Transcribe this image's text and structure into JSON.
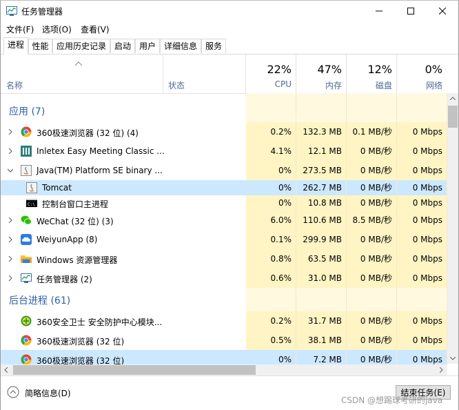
{
  "window": {
    "title": "任务管理器"
  },
  "menu": {
    "file": "文件(F)",
    "options": "选项(O)",
    "view": "查看(V)"
  },
  "tabs": [
    "进程",
    "性能",
    "应用历史记录",
    "启动",
    "用户",
    "详细信息",
    "服务"
  ],
  "header": {
    "name": "名称",
    "status": "状态",
    "cpu_pct": "22%",
    "cpu_label": "CPU",
    "mem_pct": "47%",
    "mem_label": "内存",
    "disk_pct": "12%",
    "disk_label": "磁盘",
    "net_pct": "0%",
    "net_label": "网络"
  },
  "groups": {
    "apps": "应用 (7)",
    "background": "后台进程 (61)"
  },
  "apps": [
    {
      "name": "360极速浏览器 (32 位) (4)",
      "cpu": "0.2%",
      "mem": "132.3 MB",
      "disk": "0.1 MB/秒",
      "net": "0 Mbps",
      "icon": "chrome-icon"
    },
    {
      "name": "Inletex Easy Meeting Classic ...",
      "cpu": "4.1%",
      "mem": "12.1 MB",
      "disk": "0 MB/秒",
      "net": "0 Mbps",
      "icon": "meeting-icon"
    },
    {
      "name": "Java(TM) Platform SE binary ...",
      "cpu": "0%",
      "mem": "273.5 MB",
      "disk": "0 MB/秒",
      "net": "0 Mbps",
      "icon": "java-icon"
    },
    {
      "name": "Tomcat",
      "cpu": "0%",
      "mem": "262.7 MB",
      "disk": "0 MB/秒",
      "net": "0 Mbps",
      "icon": "java-icon"
    },
    {
      "name": "控制台窗口主进程",
      "cpu": "0%",
      "mem": "10.8 MB",
      "disk": "0 MB/秒",
      "net": "0 Mbps",
      "icon": "console-icon"
    },
    {
      "name": "WeChat (32 位) (3)",
      "cpu": "6.0%",
      "mem": "110.6 MB",
      "disk": "8.5 MB/秒",
      "net": "0 Mbps",
      "icon": "wechat-icon"
    },
    {
      "name": "WeiyunApp (8)",
      "cpu": "0.1%",
      "mem": "299.9 MB",
      "disk": "0 MB/秒",
      "net": "0 Mbps",
      "icon": "weiyun-icon"
    },
    {
      "name": "Windows 资源管理器",
      "cpu": "0.8%",
      "mem": "63.5 MB",
      "disk": "0 MB/秒",
      "net": "0 Mbps",
      "icon": "folder-icon"
    },
    {
      "name": "任务管理器 (2)",
      "cpu": "0.6%",
      "mem": "31.0 MB",
      "disk": "0 MB/秒",
      "net": "0 Mbps",
      "icon": "taskmgr-icon"
    }
  ],
  "background": [
    {
      "name": "360安全卫士 安全防护中心模块...",
      "cpu": "0.2%",
      "mem": "31.7 MB",
      "disk": "0 MB/秒",
      "net": "0 Mbps",
      "icon": "360-icon"
    },
    {
      "name": "360极速浏览器 (32 位)",
      "cpu": "0.5%",
      "mem": "38.1 MB",
      "disk": "0 MB/秒",
      "net": "0 Mbps",
      "icon": "chrome-icon"
    },
    {
      "name": "360极速浏览器 (32 位)",
      "cpu": "0%",
      "mem": "7.2 MB",
      "disk": "0 MB/秒",
      "net": "0 Mbps",
      "icon": "chrome-icon"
    }
  ],
  "footer": {
    "fewer_details": "简略信息(D)",
    "end_task": "结束任务(E)",
    "watermark": "CSDN @想踢球考研的java"
  },
  "colors": {
    "heat": "#fff4c4",
    "heat_low": "#fff9e0",
    "selected": "#cce8ff",
    "group_text": "#2c5fa8"
  }
}
